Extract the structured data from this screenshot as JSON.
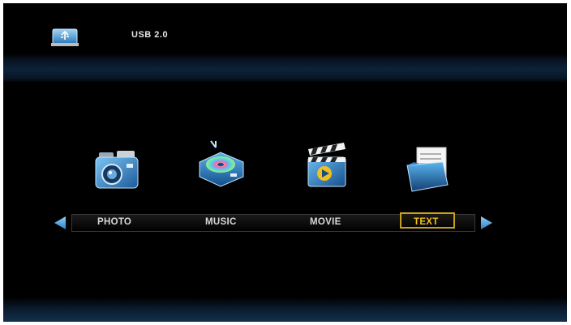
{
  "header": {
    "device_label": "USB 2.0",
    "device_icon": "usb-icon"
  },
  "menu": {
    "items": [
      {
        "label": "PHOTO",
        "icon": "camera-icon"
      },
      {
        "label": "MUSIC",
        "icon": "music-disc-icon"
      },
      {
        "label": "MOVIE",
        "icon": "clapperboard-icon"
      },
      {
        "label": "TEXT",
        "icon": "document-folder-icon"
      }
    ],
    "selected": "TEXT",
    "left_arrow": "arrow-left-icon",
    "right_arrow": "arrow-right-icon"
  },
  "colors": {
    "background": "#000000",
    "accent": "#4aa8e8",
    "selected_text": "#f0c020",
    "selected_border": "#c8a020"
  }
}
